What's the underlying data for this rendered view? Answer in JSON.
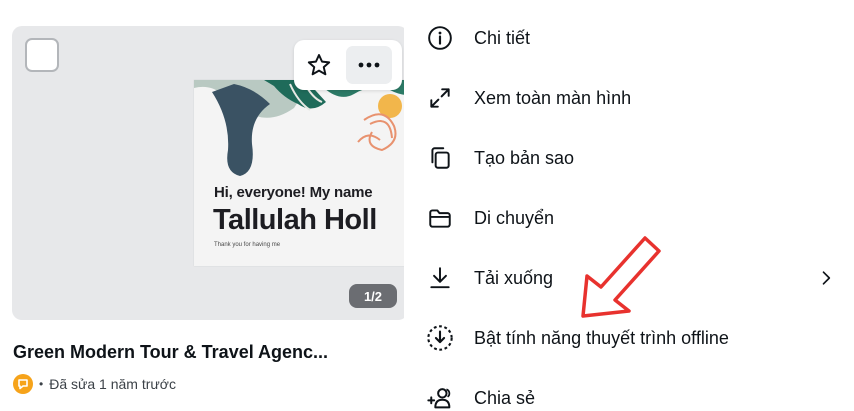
{
  "card": {
    "slide_greeting": "Hi, everyone! My name",
    "slide_name": "Tallulah Holl",
    "slide_thanks": "Thank you for having me",
    "page_indicator": "1/2",
    "title": "Green Modern Tour & Travel Agenc...",
    "meta_separator": "•",
    "meta": "Đã sửa 1 năm trước"
  },
  "menu": {
    "items": [
      {
        "label": "Chi tiết",
        "icon": "info-icon"
      },
      {
        "label": "Xem toàn màn hình",
        "icon": "expand-icon"
      },
      {
        "label": "Tạo bản sao",
        "icon": "copy-icon"
      },
      {
        "label": "Di chuyển",
        "icon": "folder-icon"
      },
      {
        "label": "Tải xuống",
        "icon": "download-icon",
        "has_submenu": true
      },
      {
        "label": "Bật tính năng thuyết trình offline",
        "icon": "offline-download-icon"
      },
      {
        "label": "Chia sẻ",
        "icon": "share-people-icon"
      }
    ]
  },
  "colors": {
    "annotation_arrow": "#e8322e",
    "avatar": "#f6a31a",
    "thumb_bg": "#e7e8ea"
  }
}
